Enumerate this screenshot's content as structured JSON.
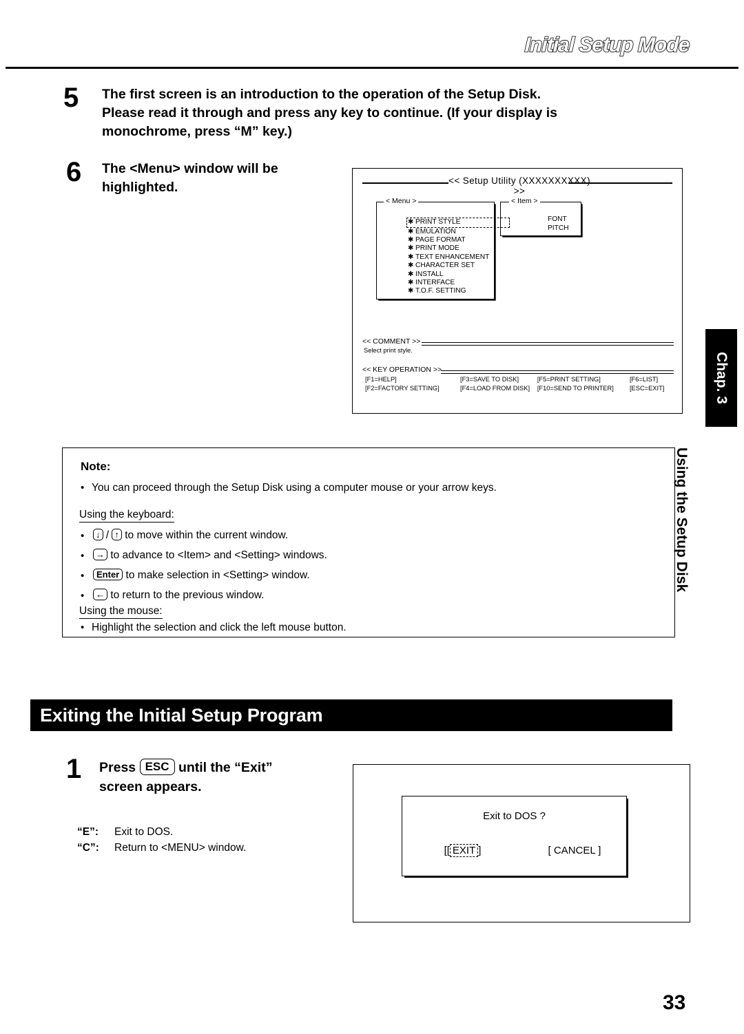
{
  "header": {
    "title": "Initial Setup Mode"
  },
  "steps": [
    {
      "number": "5",
      "line1": "The first screen is an introduction to the operation of the Setup Disk.",
      "line2": "Please read it through and press any key to continue. (If your display is",
      "line3": "monochrome, press “M” key.)"
    },
    {
      "number": "6",
      "line1": "The <Menu> window will be",
      "line2": "highlighted."
    }
  ],
  "setup_utility": {
    "title": "<<  Setup Utility (XXXXXXXXXX)  >>",
    "menu_window": {
      "label": "< Menu >",
      "items": [
        "PRINT STYLE",
        "EMULATION",
        "PAGE FORMAT",
        "PRINT MODE",
        "TEXT ENHANCEMENT",
        "CHARACTER SET",
        "INSTALL",
        "INTERFACE",
        "T.O.F. SETTING"
      ],
      "selected_index": 0,
      "bullet": "✱"
    },
    "item_window": {
      "label": "< Item >",
      "items": [
        "FONT",
        "PITCH"
      ]
    },
    "comment": {
      "heading": "<<  COMMENT  >>",
      "text": "Select print style."
    },
    "key_operation": {
      "heading": "<<  KEY OPERATION  >>",
      "keys": [
        [
          "[F1=HELP]",
          "[F3=SAVE TO DISK]",
          "[F5=PRINT SETTING]",
          "[F6=LIST]"
        ],
        [
          "[F2=FACTORY SETTING]",
          "[F4=LOAD FROM DISK]",
          "[F10=SEND TO PRINTER]",
          "[ESC=EXIT]"
        ]
      ]
    }
  },
  "note": {
    "label": "Note:",
    "bullet": "•",
    "intro": "You can proceed through the Setup Disk using a computer mouse or your arrow keys.",
    "keyboard_heading": "Using the keyboard:",
    "keyboard_items": [
      {
        "keys": [
          "↓",
          "↑"
        ],
        "separator": " / ",
        "text": "to move within the current window."
      },
      {
        "keys": [
          "→"
        ],
        "text": "to advance to <Item>  and <Setting> windows."
      },
      {
        "keys": [
          "Enter"
        ],
        "text": "to make selection in <Setting> window."
      },
      {
        "keys": [
          "←"
        ],
        "text": "to return to the previous window."
      }
    ],
    "mouse_heading": "Using the mouse:",
    "mouse_items": [
      "Highlight the selection and click the left mouse button."
    ]
  },
  "section": {
    "banner_title": "Exiting the Initial Setup Program",
    "step_number": "1",
    "step_line1_pre": "Press ",
    "step_key": "ESC",
    "step_line1_post": " until the “Exit”",
    "step_line2": "screen appears.",
    "legend": [
      {
        "key": "“E”:",
        "desc": "Exit to DOS."
      },
      {
        "key": "“C”:",
        "desc": "Return to <MENU> window."
      }
    ]
  },
  "exit_dialog": {
    "title": "Exit to DOS ?",
    "exit_button": "EXIT",
    "exit_button_outer_left": "[[",
    "exit_button_outer_right": "]",
    "cancel_button": "[  CANCEL  ]"
  },
  "side": {
    "chapter": "Chap. 3",
    "section_title": "Using the Setup Disk"
  },
  "page_number": "33"
}
